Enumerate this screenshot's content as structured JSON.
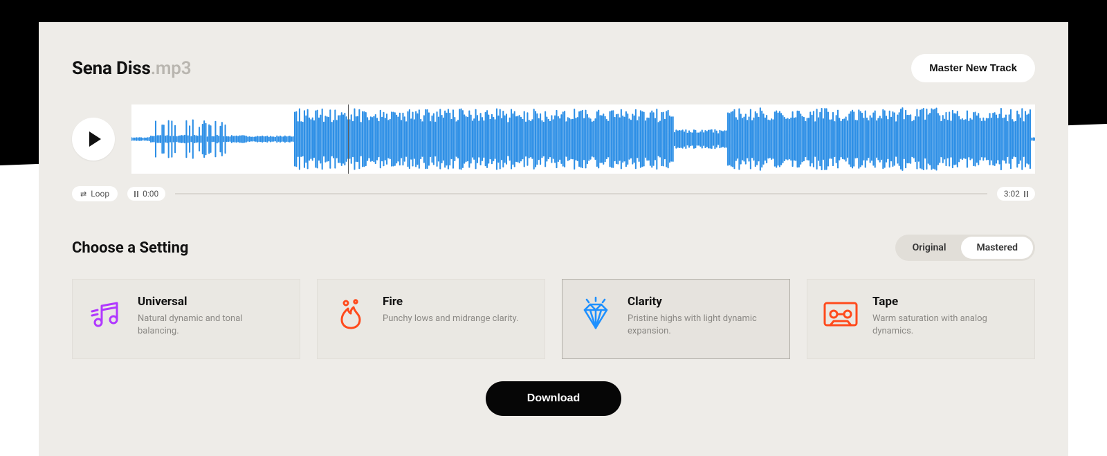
{
  "header": {
    "track_name": "Sena Diss",
    "track_ext": ".mp3",
    "master_button": "Master New Track"
  },
  "player": {
    "loop_label": "Loop",
    "time_start": "0:00",
    "time_end": "3:02",
    "playhead_percent": 24
  },
  "settings_section": {
    "title": "Choose a Setting",
    "toggle": {
      "original": "Original",
      "mastered": "Mastered",
      "active": "mastered"
    }
  },
  "settings": [
    {
      "id": "universal",
      "name": "Universal",
      "desc": "Natural dynamic and tonal balancing.",
      "icon": "music-note-icon",
      "color": "#b038ff",
      "selected": false
    },
    {
      "id": "fire",
      "name": "Fire",
      "desc": "Punchy lows and midrange clarity.",
      "icon": "flame-icon",
      "color": "#ff4a1c",
      "selected": false
    },
    {
      "id": "clarity",
      "name": "Clarity",
      "desc": "Pristine highs with light dynamic expansion.",
      "icon": "diamond-icon",
      "color": "#1e90ff",
      "selected": true
    },
    {
      "id": "tape",
      "name": "Tape",
      "desc": "Warm saturation with analog dynamics.",
      "icon": "cassette-icon",
      "color": "#ff4a1c",
      "selected": false
    }
  ],
  "download_label": "Download",
  "waveform_color": "#2d8fe6"
}
